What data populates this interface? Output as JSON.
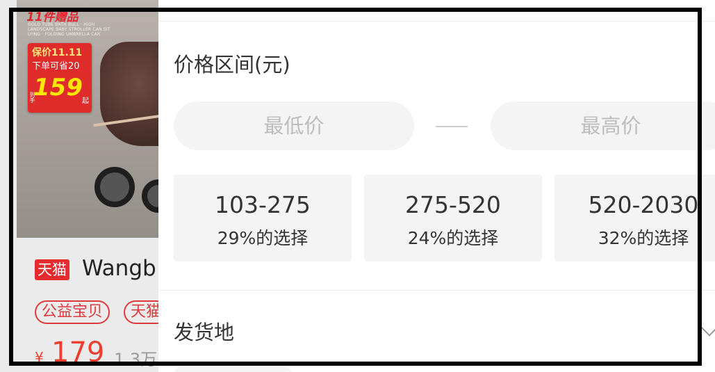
{
  "product": {
    "promo_top": "11件赠品",
    "promo_sub": "GOLD TUBE BATH BULL · HIGH LANDSCAPE BABY STROLLER CAN SIT LYING · FOLDING UMBRELLA CAR",
    "badge_line1": "保价11.11",
    "badge_line2": "下单可省20",
    "badge_price": "159",
    "badge_unit": "起",
    "badge_side": "到手",
    "platform_tag": "天猫",
    "name": "Wangb",
    "tags": [
      "公益宝贝",
      "天猫"
    ],
    "currency": "¥",
    "price": "179",
    "sales": "1.3万"
  },
  "filter": {
    "price_section_title": "价格区间(元)",
    "min_placeholder": "最低价",
    "max_placeholder": "最高价",
    "ranges": [
      {
        "label": "103-275",
        "share": "29%的选择"
      },
      {
        "label": "275-520",
        "share": "24%的选择"
      },
      {
        "label": "520-2030",
        "share": "32%的选择"
      }
    ],
    "origin_section_title": "发货地"
  },
  "colors": {
    "tmall_red": "#e52b2b",
    "price_red": "#f13d2f",
    "option_bg": "#f4f4f4",
    "frame": "#000000"
  },
  "icons": {
    "origin_expand": "chevron-down-icon"
  }
}
